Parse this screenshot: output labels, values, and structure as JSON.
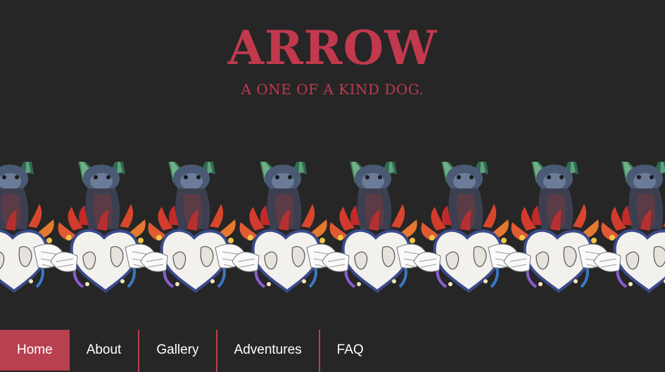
{
  "header": {
    "title": "ARROW",
    "tagline": "A ONE OF A KIND DOG."
  },
  "banner": {
    "image": "dog-heart-illustration-icon",
    "repeat_count": 8
  },
  "nav": {
    "items": [
      {
        "label": "Home",
        "active": true
      },
      {
        "label": "About",
        "active": false
      },
      {
        "label": "Gallery",
        "active": false
      },
      {
        "label": "Adventures",
        "active": false
      },
      {
        "label": "FAQ",
        "active": false
      }
    ]
  },
  "colors": {
    "background": "#262626",
    "accent": "#c2394e",
    "nav_active": "#b8404f",
    "nav_text": "#ffffff"
  }
}
